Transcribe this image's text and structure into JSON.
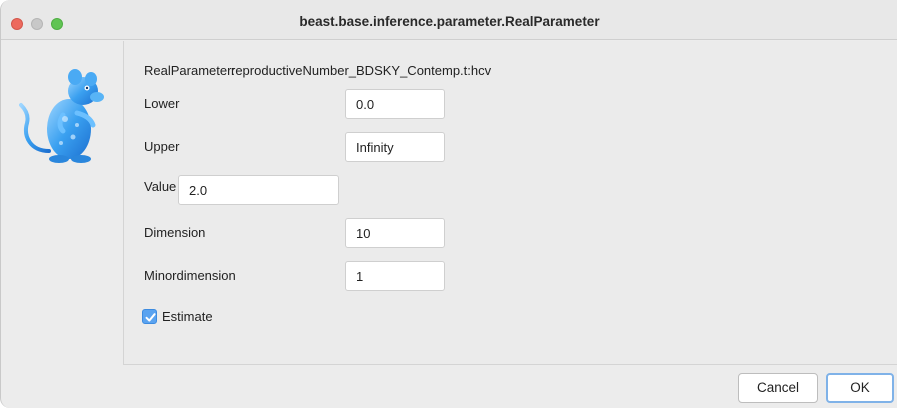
{
  "window": {
    "title": "beast.base.inference.parameter.RealParameter"
  },
  "sidebar": {
    "logo_icon": "beast-rat-logo-icon"
  },
  "form": {
    "header_label": "RealParameter:",
    "header_value": "reproductiveNumber_BDSKY_Contemp.t:hcv",
    "lower_label": "Lower",
    "lower_value": "0.0",
    "upper_label": "Upper",
    "upper_value": "Infinity",
    "value_label": "Value",
    "value_value": "2.0",
    "dimension_label": "Dimension",
    "dimension_value": "10",
    "minordimension_label": "Minordimension",
    "minordimension_value": "1",
    "estimate_label": "Estimate",
    "estimate_checked": true
  },
  "buttons": {
    "cancel_label": "Cancel",
    "ok_label": "OK"
  },
  "colors": {
    "accent": "#5aa3f0",
    "close": "#ed6a5e",
    "minimize_inactive": "#c8c8c8",
    "maximize": "#61c454"
  }
}
